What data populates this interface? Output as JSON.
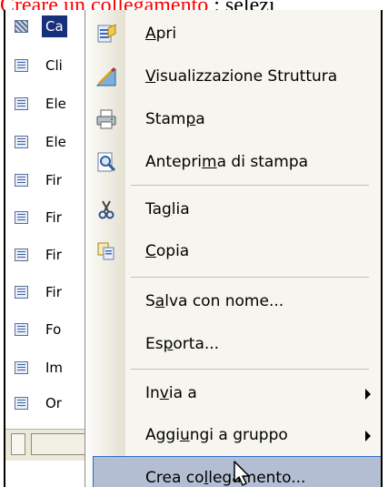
{
  "caption": {
    "title_red": "Creare un collegamento",
    "title_black": ": selezi"
  },
  "list": {
    "items": [
      {
        "label": "Ca",
        "icon": "table-icon-dotted",
        "selected": true
      },
      {
        "label": "Cli",
        "icon": "table-icon"
      },
      {
        "label": "Ele",
        "icon": "table-icon"
      },
      {
        "label": "Ele",
        "icon": "table-icon"
      },
      {
        "label": "Fir",
        "icon": "table-icon"
      },
      {
        "label": "Fir",
        "icon": "table-icon"
      },
      {
        "label": "Fir",
        "icon": "table-icon"
      },
      {
        "label": "Fir",
        "icon": "table-icon"
      },
      {
        "label": "Fo",
        "icon": "table-icon"
      },
      {
        "label": "Im",
        "icon": "table-icon"
      },
      {
        "label": "Or",
        "icon": "table-icon"
      }
    ]
  },
  "menu": {
    "items": [
      {
        "pre": "",
        "u": "A",
        "post": "pri",
        "icon": "open-icon"
      },
      {
        "pre": "",
        "u": "V",
        "post": "isualizzazione Struttura",
        "icon": "design-view-icon"
      },
      {
        "pre": "Stam",
        "u": "p",
        "post": "a",
        "icon": "printer-icon"
      },
      {
        "pre": "Anteprima di stampa",
        "u": "",
        "post": "",
        "icon": "print-preview-icon"
      },
      {
        "pre": "Ta",
        "u": "g",
        "post": "lia",
        "icon": "scissors-icon"
      },
      {
        "pre": "",
        "u": "C",
        "post": "opia",
        "icon": "copy-icon"
      },
      {
        "pre": "S",
        "u": "a",
        "post": "lva con nome...",
        "icon": ""
      },
      {
        "pre": "Es",
        "u": "p",
        "post": "orta...",
        "icon": ""
      },
      {
        "pre": "In",
        "u": "v",
        "post": "ia a",
        "icon": "",
        "submenu": true
      },
      {
        "pre": "Aggi",
        "u": "u",
        "post": "ngi a gruppo",
        "icon": "",
        "submenu": true
      },
      {
        "pre": "Crea co",
        "u": "l",
        "post": "legamento...",
        "icon": "",
        "highlight": true
      }
    ]
  }
}
